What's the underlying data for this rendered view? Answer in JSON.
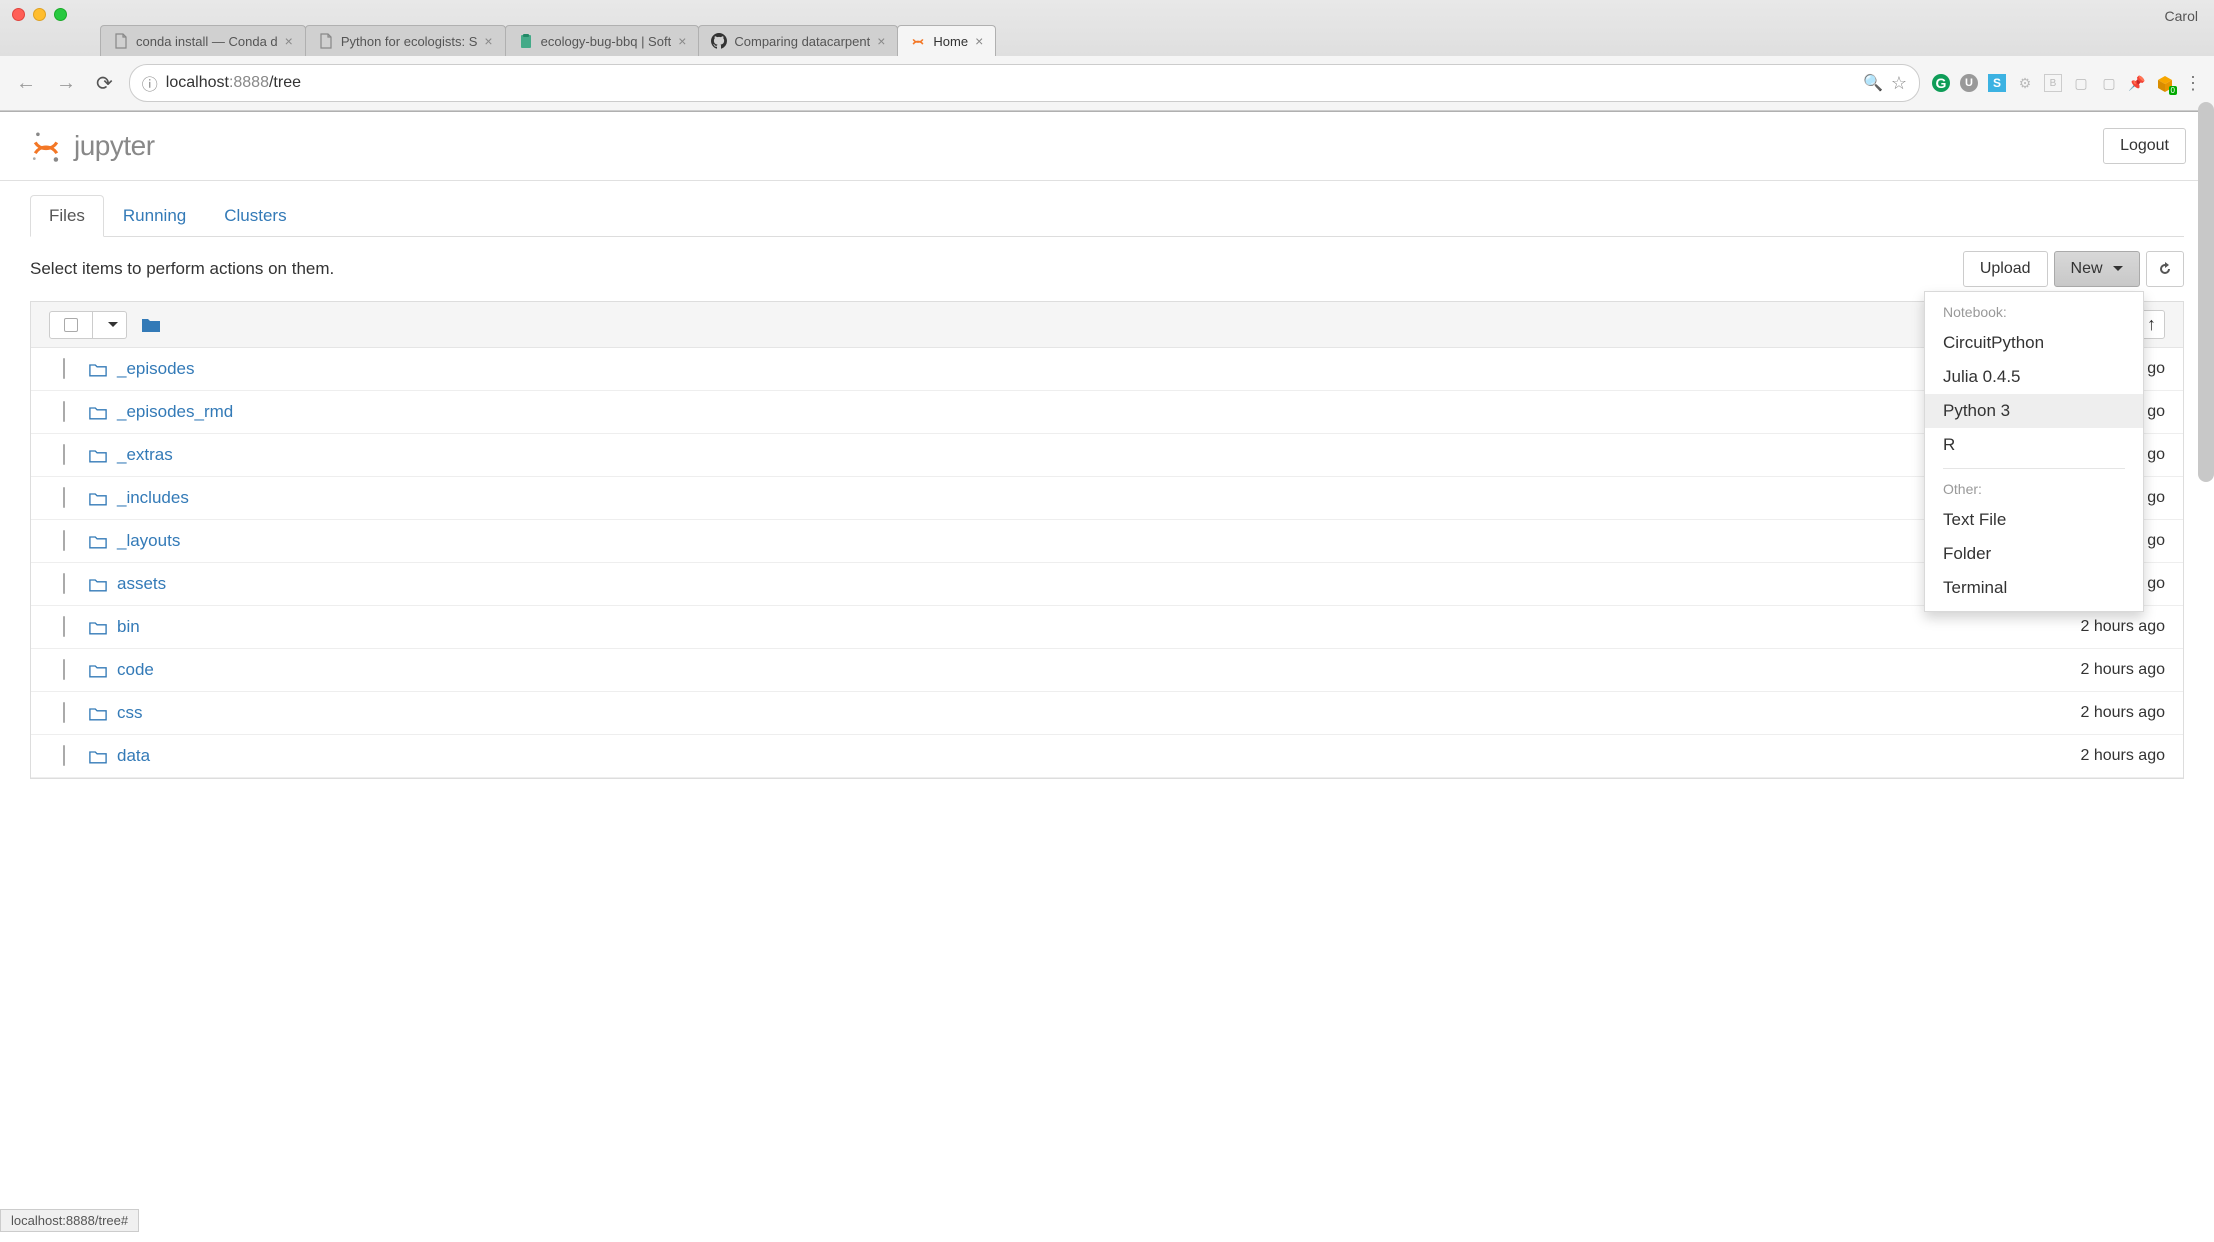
{
  "browser": {
    "profile": "Carol",
    "tabs": [
      {
        "title": "conda install — Conda d",
        "favicon": "page"
      },
      {
        "title": "Python for ecologists: S",
        "favicon": "page"
      },
      {
        "title": "ecology-bug-bbq | Soft",
        "favicon": "clipboard-green"
      },
      {
        "title": "Comparing datacarpent",
        "favicon": "github"
      },
      {
        "title": "Home",
        "favicon": "jupyter",
        "active": true
      }
    ],
    "url_host": "localhost",
    "url_port": ":8888",
    "url_path": "/tree",
    "status_url": "localhost:8888/tree#"
  },
  "jupyter": {
    "logo_text": "jupyter",
    "logout": "Logout",
    "nav_tabs": [
      {
        "label": "Files",
        "active": true
      },
      {
        "label": "Running",
        "active": false
      },
      {
        "label": "Clusters",
        "active": false
      }
    ],
    "action_text": "Select items to perform actions on them.",
    "upload_label": "Upload",
    "new_label": "New",
    "dropdown": {
      "section1": "Notebook:",
      "items1": [
        {
          "label": "CircuitPython",
          "hl": false
        },
        {
          "label": "Julia 0.4.5",
          "hl": false
        },
        {
          "label": "Python 3",
          "hl": true
        },
        {
          "label": "R",
          "hl": false
        }
      ],
      "section2": "Other:",
      "items2": [
        {
          "label": "Text File"
        },
        {
          "label": "Folder"
        },
        {
          "label": "Terminal"
        }
      ]
    },
    "files": [
      {
        "name": "_episodes",
        "time": "go"
      },
      {
        "name": "_episodes_rmd",
        "time": "go"
      },
      {
        "name": "_extras",
        "time": "go"
      },
      {
        "name": "_includes",
        "time": "go"
      },
      {
        "name": "_layouts",
        "time": "go"
      },
      {
        "name": "assets",
        "time": "go"
      },
      {
        "name": "bin",
        "time": "2 hours ago"
      },
      {
        "name": "code",
        "time": "2 hours ago"
      },
      {
        "name": "css",
        "time": "2 hours ago"
      },
      {
        "name": "data",
        "time": "2 hours ago"
      }
    ]
  }
}
